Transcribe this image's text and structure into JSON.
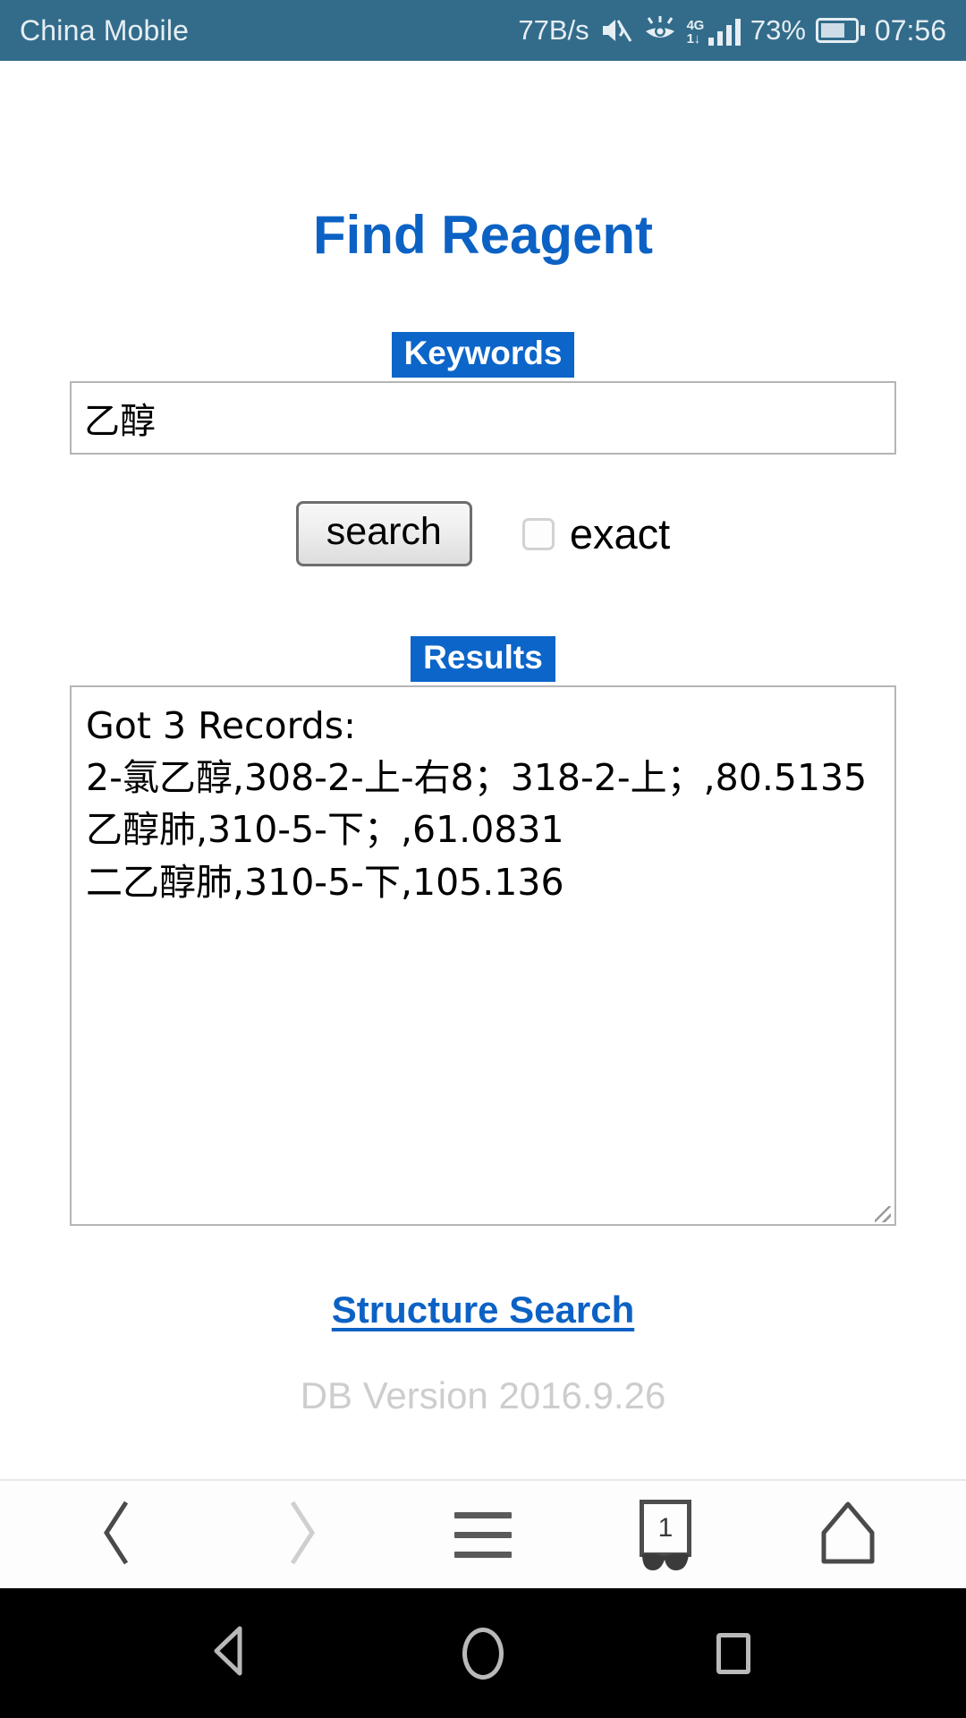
{
  "status_bar": {
    "carrier": "China Mobile",
    "network_speed": "77B/s",
    "battery_percent": "73%",
    "battery_level": 73,
    "clock": "07:56",
    "network_type_top": "4G",
    "network_type_bottom": "1↓",
    "icons": [
      "mute-icon",
      "eye-comfort-icon",
      "signal-icon",
      "battery-icon"
    ],
    "background_color": "#336c8b",
    "text_color": "#e6eef3"
  },
  "page": {
    "title": "Find Reagent",
    "title_color": "#0c62c4",
    "keywords_label": "Keywords",
    "badge_color": "#0c65c9",
    "keyword_value": "乙醇",
    "keyword_placeholder": "",
    "search_button_label": "search",
    "exact_label": "exact",
    "exact_checked": false,
    "results_label": "Results",
    "results_text": "Got 3 Records:\n2-氯乙醇,308-2-上-右8；318-2-上；,80.5135\n乙醇肺,310-5-下；,61.0831\n二乙醇肺,310-5-下,105.136",
    "results": {
      "header": "Got 3 Records:",
      "count": 3,
      "records": [
        {
          "name": "2-氯乙醇",
          "locations": "308-2-上-右8；318-2-上；",
          "value": "80.5135"
        },
        {
          "name": "乙醇肺",
          "locations": "310-5-下；",
          "value": "61.0831"
        },
        {
          "name": "二乙醇肺",
          "locations": "310-5-下",
          "value": "105.136"
        }
      ]
    },
    "structure_search_link": "Structure Search",
    "link_color": "#0c62c4",
    "db_version": "DB Version 2016.9.26",
    "db_version_color": "#cdcdcd"
  },
  "browser_toolbar": {
    "items": [
      {
        "name": "back",
        "icon": "chevron-left-icon",
        "enabled": true
      },
      {
        "name": "forward",
        "icon": "chevron-right-icon",
        "enabled": false
      },
      {
        "name": "menu",
        "icon": "hamburger-menu-icon",
        "enabled": true
      },
      {
        "name": "tabs",
        "icon": "tabs-incognito-icon",
        "enabled": true,
        "count": "1"
      },
      {
        "name": "home",
        "icon": "home-icon",
        "enabled": true
      }
    ],
    "tab_count": "1"
  },
  "android_nav": {
    "items": [
      {
        "name": "back",
        "icon": "triangle-back-icon"
      },
      {
        "name": "home",
        "icon": "circle-home-icon"
      },
      {
        "name": "recents",
        "icon": "square-recents-icon"
      }
    ],
    "background_color": "#000000"
  }
}
